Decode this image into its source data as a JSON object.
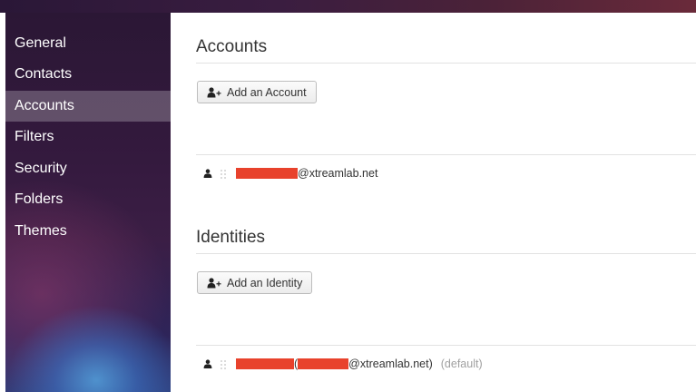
{
  "nav": {
    "items": [
      {
        "label": "General"
      },
      {
        "label": "Contacts"
      },
      {
        "label": "Accounts",
        "active": true
      },
      {
        "label": "Filters"
      },
      {
        "label": "Security"
      },
      {
        "label": "Folders"
      },
      {
        "label": "Themes"
      }
    ]
  },
  "accounts": {
    "title": "Accounts",
    "add_button": "Add an Account",
    "items": [
      {
        "email_suffix": "@xtreamlab.net"
      }
    ]
  },
  "identities": {
    "title": "Identities",
    "add_button": "Add an Identity",
    "items": [
      {
        "open_paren": "(",
        "email_suffix": "@xtreamlab.net)",
        "tag": "(default)"
      }
    ]
  },
  "icons": {
    "user": "user-icon",
    "add_user": "add-user-icon",
    "drag": "drag-handle-icon"
  },
  "colors": {
    "redaction": "#e8422c",
    "active_nav_bg": "rgba(255,255,255,0.24)"
  }
}
